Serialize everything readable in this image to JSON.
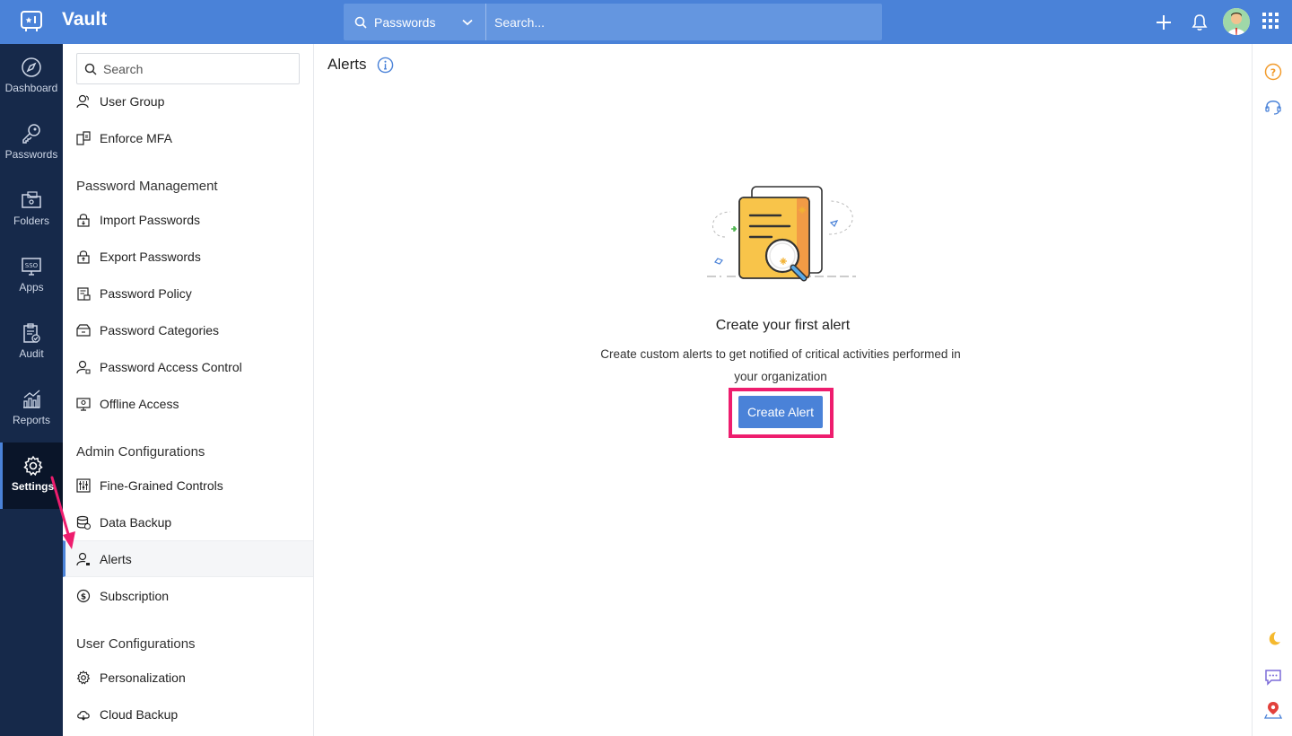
{
  "app": {
    "title": "Vault"
  },
  "topbar": {
    "search_scope": "Passwords",
    "search_placeholder": "Search..."
  },
  "rail": {
    "items": [
      {
        "label": "Dashboard",
        "icon": "compass-icon"
      },
      {
        "label": "Passwords",
        "icon": "key-icon"
      },
      {
        "label": "Folders",
        "icon": "folder-icon"
      },
      {
        "label": "Apps",
        "icon": "sso-icon"
      },
      {
        "label": "Audit",
        "icon": "clipboard-icon"
      },
      {
        "label": "Reports",
        "icon": "chart-icon"
      },
      {
        "label": "Settings",
        "icon": "gear-icon"
      }
    ]
  },
  "subnav": {
    "search_placeholder": "Search",
    "items_top": [
      {
        "label": "User Group",
        "icon": "users-icon"
      },
      {
        "label": "Enforce MFA",
        "icon": "mfa-icon"
      }
    ],
    "sections": [
      {
        "title": "Password Management",
        "items": [
          {
            "label": "Import Passwords",
            "icon": "lock-import-icon"
          },
          {
            "label": "Export Passwords",
            "icon": "lock-export-icon"
          },
          {
            "label": "Password Policy",
            "icon": "policy-icon"
          },
          {
            "label": "Password Categories",
            "icon": "categories-icon"
          },
          {
            "label": "Password Access Control",
            "icon": "user-lock-icon"
          },
          {
            "label": "Offline Access",
            "icon": "offline-icon"
          }
        ]
      },
      {
        "title": "Admin Configurations",
        "items": [
          {
            "label": "Fine-Grained Controls",
            "icon": "sliders-icon"
          },
          {
            "label": "Data Backup",
            "icon": "database-icon"
          },
          {
            "label": "Alerts",
            "icon": "user-alert-icon"
          },
          {
            "label": "Subscription",
            "icon": "dollar-icon"
          }
        ]
      },
      {
        "title": "User Configurations",
        "items": [
          {
            "label": "Personalization",
            "icon": "gear-icon"
          },
          {
            "label": "Cloud Backup",
            "icon": "cloud-icon"
          }
        ]
      }
    ]
  },
  "main": {
    "page_title": "Alerts",
    "empty_title": "Create your first alert",
    "empty_desc": "Create custom alerts to get notified of critical activities performed in your organization",
    "create_button": "Create Alert"
  },
  "colors": {
    "accent": "#4a82d8",
    "rail_bg": "#16294a",
    "highlight": "#ee1d6e"
  }
}
